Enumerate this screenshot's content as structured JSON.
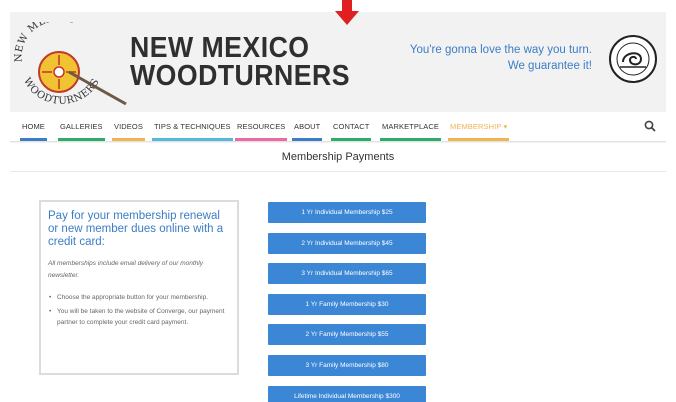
{
  "header": {
    "brand_line1": "NEW MEXICO",
    "brand_line2": "WOODTURNERS",
    "tagline_line1": "You're gonna love the way you turn.",
    "tagline_line2": "We guarantee it!",
    "logo_left_top_text": "NEW MEXICO",
    "logo_left_bottom_text": "WOODTURNERS",
    "accent_color": "#3b7dc6"
  },
  "nav": {
    "items": [
      {
        "label": "HOME",
        "bar": "#3b7dc6"
      },
      {
        "label": "GALLERIES",
        "bar": "#2eaa6b"
      },
      {
        "label": "VIDEOS",
        "bar": "#f0b451"
      },
      {
        "label": "TIPS & TECHNIQUES",
        "bar": "#56b8d6"
      },
      {
        "label": "RESOURCES",
        "bar": "#e96aa4"
      },
      {
        "label": "ABOUT",
        "bar": "#3b7dc6"
      },
      {
        "label": "CONTACT",
        "bar": "#2eaa6b"
      },
      {
        "label": "MARKETPLACE",
        "bar": "#2eaa6b"
      },
      {
        "label": "MEMBERSHIP ▾",
        "bar": "#f0b451"
      }
    ],
    "search_icon": "search-icon"
  },
  "page": {
    "title": "Membership Payments"
  },
  "info": {
    "heading": "Pay for your membership renewal or new member dues online with a credit card:",
    "note": "All memberships include email delivery of our monthly newsletter.",
    "bullets": [
      "Choose the appropriate button for your membership.",
      "You will be taken to the website of Converge, our payment partner to complete your credit card payment."
    ]
  },
  "buttons": [
    "1 Yr Individual Membership $25",
    "2 Yr Individual Membership $45",
    "3 Yr Individual Membership $65",
    "1 Yr Family Membership $30",
    "2 Yr Family Membership $55",
    "3 Yr Family Membership $80",
    "Lifetime Individual Membership $300"
  ],
  "colors": {
    "button": "#3b87d6",
    "arrow": "#e02020"
  }
}
